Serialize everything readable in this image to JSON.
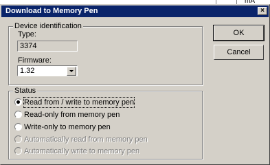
{
  "background": {
    "top_right_text": "mA"
  },
  "dialog": {
    "title": "Download to Memory Pen",
    "close_glyph": "×"
  },
  "device_identification": {
    "group_label": "Device identification",
    "type_label": "Type:",
    "type_value": "3374",
    "firmware_label": "Firmware:",
    "firmware_value": "1.32"
  },
  "buttons": {
    "ok_label": "OK",
    "cancel_label": "Cancel"
  },
  "status": {
    "group_label": "Status",
    "options": [
      {
        "label": "Read from / write to memory pen",
        "checked": true,
        "enabled": true
      },
      {
        "label": "Read-only from memory pen",
        "checked": false,
        "enabled": true
      },
      {
        "label": "Write-only to memory pen",
        "checked": false,
        "enabled": true
      },
      {
        "label": "Automatically read from memory pen",
        "checked": false,
        "enabled": false
      },
      {
        "label": "Automatically write to memory pen",
        "checked": false,
        "enabled": false
      }
    ]
  },
  "colors": {
    "title_bar": "#0a246a",
    "dialog_face": "#d4d0c8",
    "disabled_text": "#808080"
  }
}
